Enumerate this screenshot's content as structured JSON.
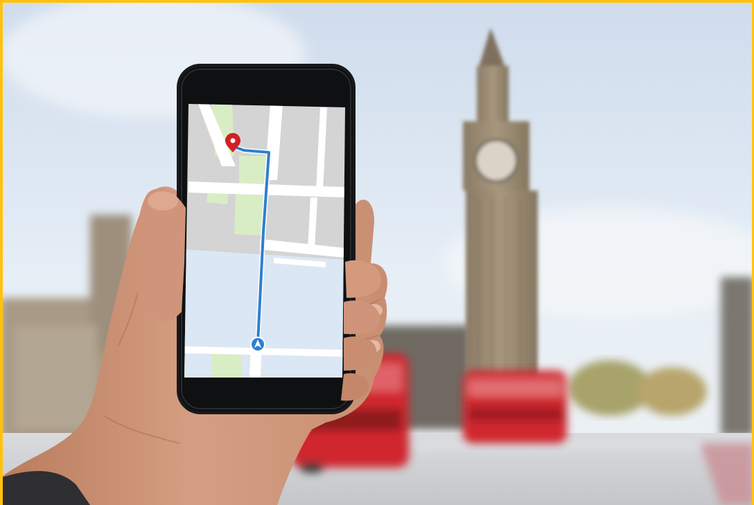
{
  "photo": {
    "frame_color": "#ffc20e",
    "subject": "hand-holding-smartphone-with-map",
    "background": "big-ben-and-red-buses-blurred"
  },
  "map": {
    "route_color": "#2f7fd0",
    "destination_pin_color": "#d21f25",
    "current_location_color": "#2f7fd0",
    "water_color": "#dbe7f4",
    "park_color": "#d9edc5",
    "block_color": "#d4d4d4",
    "road_color": "#ffffff",
    "destination_icon": "map-pin-icon",
    "location_icon": "navigation-arrow-icon"
  },
  "colors": {
    "sky": "#dfe8f3",
    "bus_red": "#d0282d",
    "tower_stone": "#9a8a73"
  }
}
